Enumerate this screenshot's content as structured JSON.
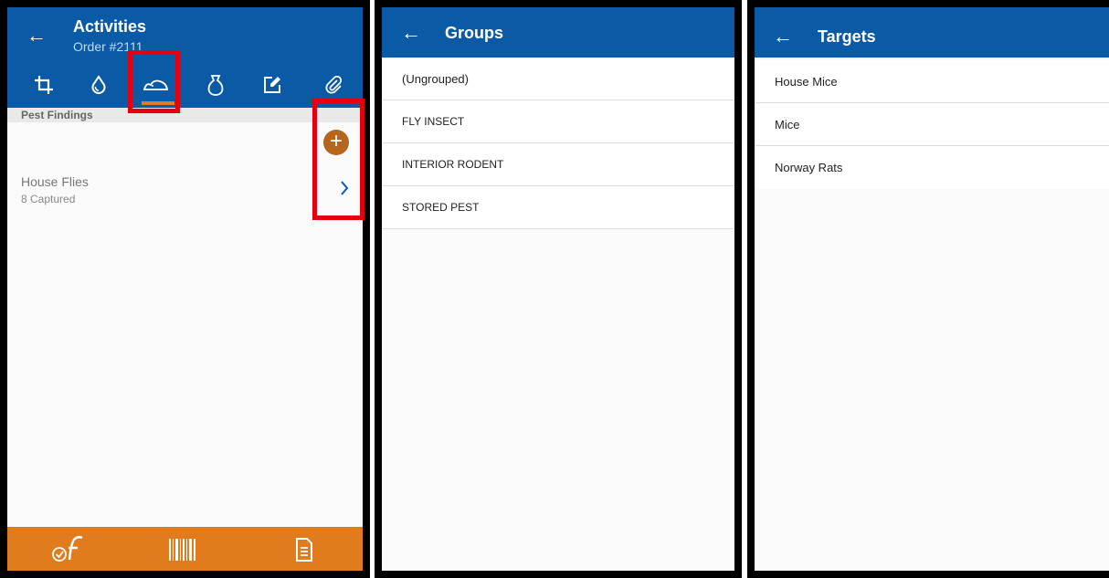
{
  "activities": {
    "title": "Activities",
    "subtitle": "Order #2111",
    "tabs": [
      "crop-icon",
      "droplet-icon",
      "rodent-icon",
      "bag-icon",
      "edit-icon",
      "attachment-icon"
    ],
    "section_header": "Pest Findings",
    "items": [
      {
        "name": "House Flies",
        "detail": "8 Captured"
      }
    ],
    "bottom_bar": [
      "signature-check-icon",
      "barcode-icon",
      "document-icon"
    ]
  },
  "groups": {
    "title": "Groups",
    "items": [
      "(Ungrouped)",
      "FLY INSECT",
      "INTERIOR RODENT",
      "STORED PEST"
    ]
  },
  "targets": {
    "title": "Targets",
    "items": [
      "House Mice",
      "Mice",
      "Norway Rats"
    ]
  },
  "colors": {
    "header_blue": "#0a5aa6",
    "accent_orange": "#e07b1e",
    "add_button_brown": "#b5651d",
    "highlight_red": "#e4000f"
  }
}
